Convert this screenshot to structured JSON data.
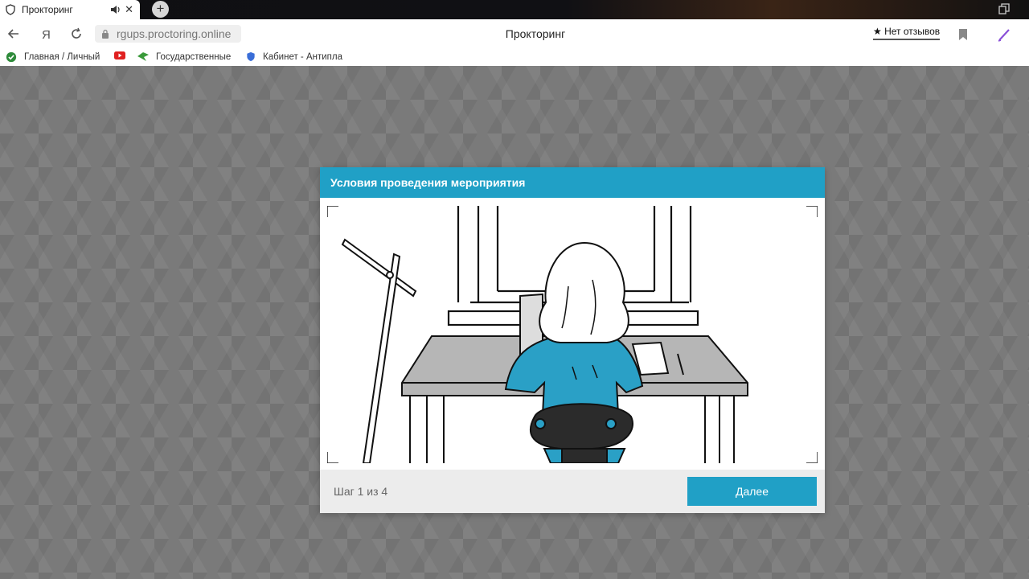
{
  "browser": {
    "tab": {
      "title": "Прокторинг",
      "close_glyph": "✕",
      "icon": "shield-icon"
    },
    "new_tab_glyph": "+",
    "address": {
      "url": "rgups.proctoring.online",
      "page_title": "Прокторинг",
      "reviews_label": "★ Нет отзывов"
    },
    "bookmarks": [
      {
        "label": "Главная / Личный",
        "icon": "check-circle-icon",
        "color": "#2e8b3a"
      },
      {
        "label": "",
        "icon": "youtube-icon",
        "color": "#e02020"
      },
      {
        "label": "Государственные",
        "icon": "gosuslugi-icon",
        "color": "#3a9a3a"
      },
      {
        "label": "Кабинет - Антипла",
        "icon": "shield-blue-icon",
        "color": "#3a6ed8"
      }
    ]
  },
  "modal": {
    "title": "Условия проведения мероприятия",
    "step_text": "Шаг 1 из 4",
    "next_label": "Далее",
    "accent_color": "#20a0c6"
  }
}
